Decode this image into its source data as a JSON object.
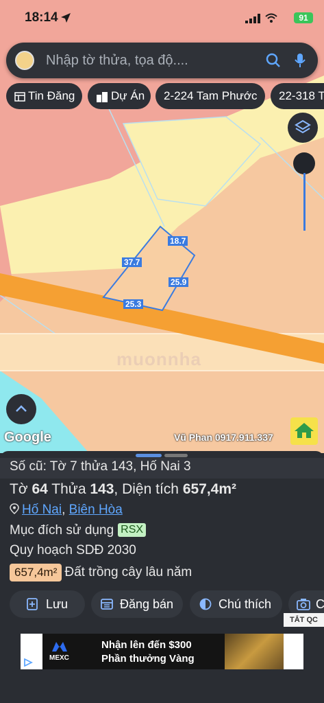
{
  "status_bar": {
    "time": "18:14",
    "battery": "91"
  },
  "search": {
    "placeholder": "Nhập tờ thửa, tọa độ...."
  },
  "chips": [
    {
      "label": "Tin Đăng",
      "icon": "list-icon"
    },
    {
      "label": "Dự Án",
      "icon": "buildings-icon"
    },
    {
      "label": "2-224 Tam Phước"
    },
    {
      "label": "22-318 T"
    }
  ],
  "map": {
    "parcel_edges": [
      "18.7",
      "37.7",
      "25.9",
      "25.3"
    ],
    "watermark": "muonnha",
    "attribution": "Google",
    "owner_label": "Vũ Phan 0917.911.337"
  },
  "panel": {
    "old_ref": "Số cũ: Tờ 7 thửa 143, Hố Nai 3",
    "title": {
      "sheet_prefix": "Tờ",
      "sheet": "64",
      "parcel_prefix": "Thửa",
      "parcel": "143",
      "area_prefix": ", Diện tích",
      "area": "657,4m²"
    },
    "location": {
      "ward": "Hố Nai",
      "sep": ",",
      "city": "Biên Hòa"
    },
    "purpose": {
      "label": "Mục đích sử dụng",
      "code": "RSX"
    },
    "planning": "Quy hoạch SDĐ 2030",
    "land": {
      "area": "657,4m²",
      "type": "Đất trồng cây lâu năm"
    },
    "actions": [
      {
        "label": "Lưu",
        "icon": "save-icon"
      },
      {
        "label": "Đăng bán",
        "icon": "post-icon"
      },
      {
        "label": "Chú thích",
        "icon": "legend-icon"
      },
      {
        "label": "C",
        "icon": "camera-icon"
      }
    ],
    "ad_close": "TẮT QC",
    "ad": {
      "brand": "MEXC",
      "line1": "Nhận lên đến $300",
      "line2": "Phần thưởng Vàng"
    }
  },
  "colors": {
    "panel_bg": "#2a2d33",
    "accent_blue": "#3a7be0",
    "link": "#5fa7ff",
    "road": "#f5a033",
    "parcel_fill": "#f8cfa3",
    "residential": "#fbf0b0",
    "forest": "#f1a69a",
    "water": "#8fe8ee"
  }
}
